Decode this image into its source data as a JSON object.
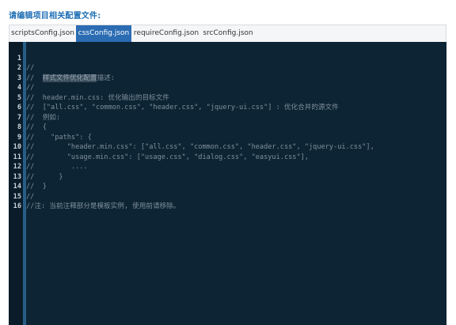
{
  "heading": "请编辑项目相关配置文件:",
  "tabs": [
    {
      "label": "scriptsConfig.json",
      "active": false
    },
    {
      "label": "cssConfig.json",
      "active": true
    },
    {
      "label": "requireConfig.json",
      "active": false
    },
    {
      "label": "srcConfig.json",
      "active": false
    }
  ],
  "editor": {
    "selected_text": "样式文件优化配置",
    "lines": [
      {
        "num": "1",
        "text": "//"
      },
      {
        "num": "2",
        "text_before": "//  ",
        "text_after": "描述:"
      },
      {
        "num": "3",
        "text": "//"
      },
      {
        "num": "4",
        "text": "//  header.min.css: 优化输出的目标文件"
      },
      {
        "num": "5",
        "text": "//  [\"all.css\", \"common.css\", \"header.css\", \"jquery-ui.css\"] : 优化合并的源文件"
      },
      {
        "num": "6",
        "text": "//  例如:"
      },
      {
        "num": "7",
        "text": "//  {"
      },
      {
        "num": "8",
        "text": "//    \"paths\": {"
      },
      {
        "num": "9",
        "text": "//        \"header.min.css\": [\"all.css\", \"common.css\", \"header.css\", \"jquery-ui.css\"],"
      },
      {
        "num": "10",
        "text": "//        \"usage.min.css\": [\"usage.css\", \"dialog.css\", \"easyui.css\"],"
      },
      {
        "num": "11",
        "text": "//         ...."
      },
      {
        "num": "12",
        "text": "//      }"
      },
      {
        "num": "13",
        "text": "//  }"
      },
      {
        "num": "14",
        "text": "//"
      },
      {
        "num": "15",
        "text": "//注: 当前注释部分是模板实例, 使用前请移除。"
      },
      {
        "num": "16",
        "text": ""
      }
    ]
  },
  "colors": {
    "heading": "#1f6fb5",
    "tab_active_bg": "#2b6cb3",
    "editor_bg": "#0d2434",
    "gutter_bg": "#0a1c29",
    "active_bar": "#275e87",
    "comment_text": "#7f8f9c",
    "line_number": "#c9d2da"
  }
}
